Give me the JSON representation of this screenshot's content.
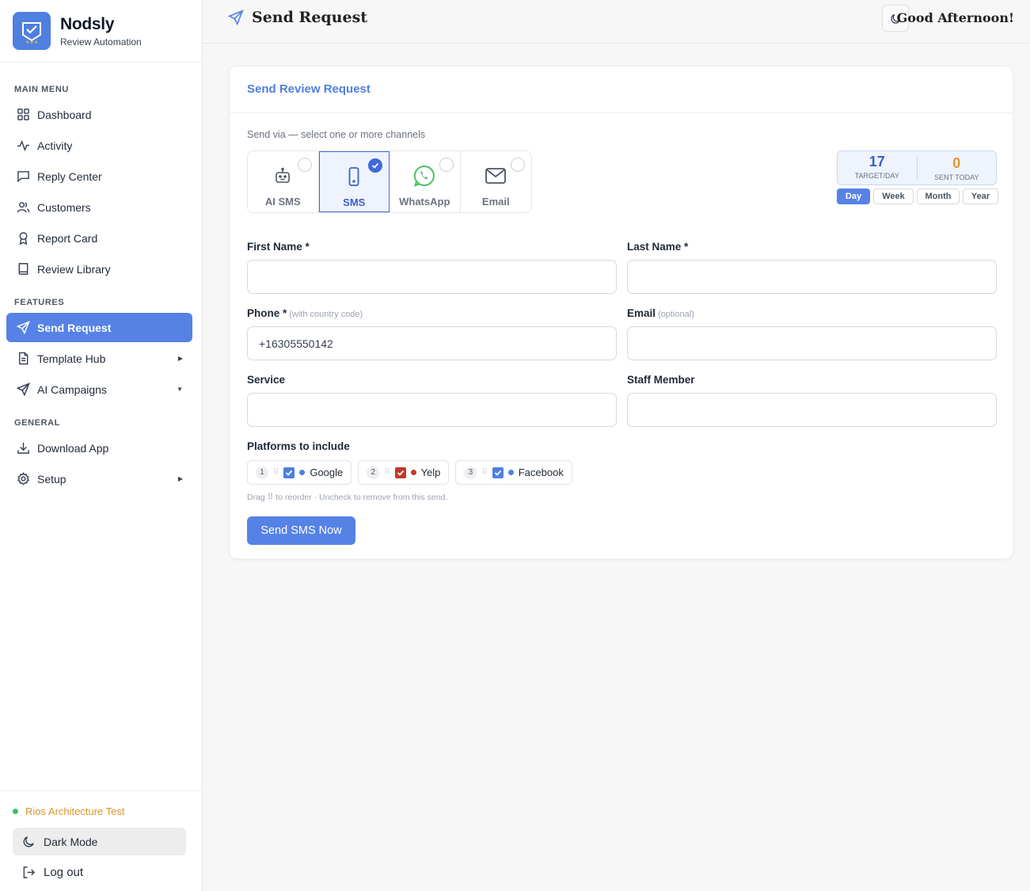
{
  "brand": {
    "name": "Nodsly",
    "subtitle": "Review Automation"
  },
  "sidebar": {
    "sections": {
      "main": "MAIN MENU",
      "features": "FEATURES",
      "general": "GENERAL"
    },
    "main_items": [
      {
        "label": "Dashboard",
        "icon": "grid-icon"
      },
      {
        "label": "Activity",
        "icon": "activity-icon"
      },
      {
        "label": "Reply Center",
        "icon": "chat-icon"
      },
      {
        "label": "Customers",
        "icon": "users-icon"
      },
      {
        "label": "Report Card",
        "icon": "award-icon"
      },
      {
        "label": "Review Library",
        "icon": "book-icon"
      }
    ],
    "feature_items": [
      {
        "label": "Send Request",
        "icon": "send-icon",
        "active": true
      },
      {
        "label": "Template Hub",
        "icon": "file-icon"
      },
      {
        "label": "AI Campaigns",
        "icon": "send-icon"
      }
    ],
    "general_items": [
      {
        "label": "Download App",
        "icon": "download-icon"
      },
      {
        "label": "Setup",
        "icon": "gear-icon"
      }
    ],
    "business_name": "Rios Architecture Test",
    "dark_mode_label": "Dark Mode",
    "logout_label": "Log out"
  },
  "header": {
    "title": "Send Request",
    "greeting": "Good Afternoon!"
  },
  "card": {
    "title": "Send Review Request",
    "send_via": "Send via — select one or more channels",
    "channels": [
      {
        "label": "AI SMS",
        "icon": "robot-icon",
        "selected": false
      },
      {
        "label": "SMS",
        "icon": "phone-icon",
        "selected": true
      },
      {
        "label": "WhatsApp",
        "icon": "whatsapp-icon",
        "selected": false
      },
      {
        "label": "Email",
        "icon": "mail-icon",
        "selected": false
      }
    ],
    "stats": {
      "target": {
        "value": "17",
        "label": "TARGET/DAY"
      },
      "sent": {
        "value": "0",
        "label": "SENT TODAY"
      }
    },
    "periods": [
      "Day",
      "Week",
      "Month",
      "Year"
    ],
    "active_period": "Day",
    "fields": {
      "first_name": {
        "label": "First Name *",
        "value": ""
      },
      "last_name": {
        "label": "Last Name *",
        "value": ""
      },
      "phone": {
        "label": "Phone *",
        "hint": "(with country code)",
        "value": "+16305550142"
      },
      "email": {
        "label": "Email",
        "hint": "(optional)",
        "value": ""
      },
      "service": {
        "label": "Service",
        "value": ""
      },
      "staff": {
        "label": "Staff Member",
        "value": ""
      }
    },
    "platforms_label": "Platforms to include",
    "platforms": [
      {
        "order": "1",
        "name": "Google",
        "checked": true,
        "color": "#4f7fe0",
        "check_color": "#4f7fe0"
      },
      {
        "order": "2",
        "name": "Yelp",
        "checked": true,
        "color": "#c0392b",
        "check_color": "#c0392b"
      },
      {
        "order": "3",
        "name": "Facebook",
        "checked": true,
        "color": "#4f7fe0",
        "check_color": "#4f7fe0"
      }
    ],
    "drag_hint": "Drag ⠿ to reorder · Uncheck to remove from this send.",
    "send_button": "Send SMS Now"
  },
  "colors": {
    "accent": "#5682e6",
    "brand_blue": "#4f7fe0",
    "orange": "#e6952f",
    "status_green": "#3dbf6a"
  }
}
